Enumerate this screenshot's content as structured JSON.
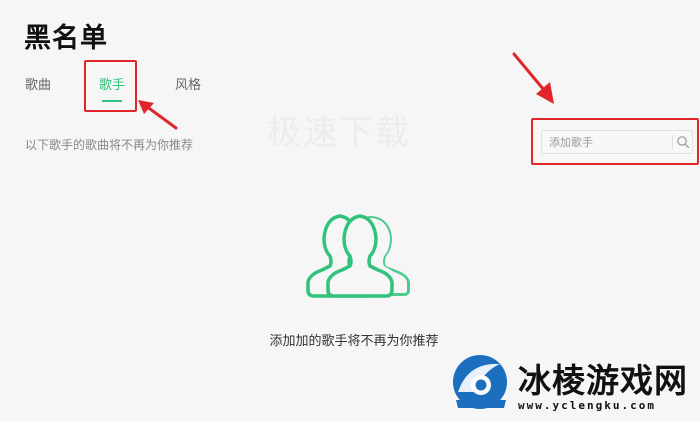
{
  "header": {
    "title": "黑名单"
  },
  "tabs": [
    {
      "label": "歌曲",
      "active": false
    },
    {
      "label": "歌手",
      "active": true
    },
    {
      "label": "风格",
      "active": false
    }
  ],
  "description": "以下歌手的歌曲将不再为你推荐",
  "search": {
    "placeholder": "添加歌手",
    "value": "",
    "icon": "search-icon"
  },
  "empty_state": {
    "icon": "users-icon",
    "message": "添加加的歌手将不再为你推荐"
  },
  "overlay": {
    "watermark_text": "极速下载",
    "brand_name": "冰棱游戏网",
    "brand_url": "www.yclengku.com"
  },
  "colors": {
    "accent": "#31c27c",
    "annotation": "#e0262a",
    "background": "#f6f6f6"
  }
}
